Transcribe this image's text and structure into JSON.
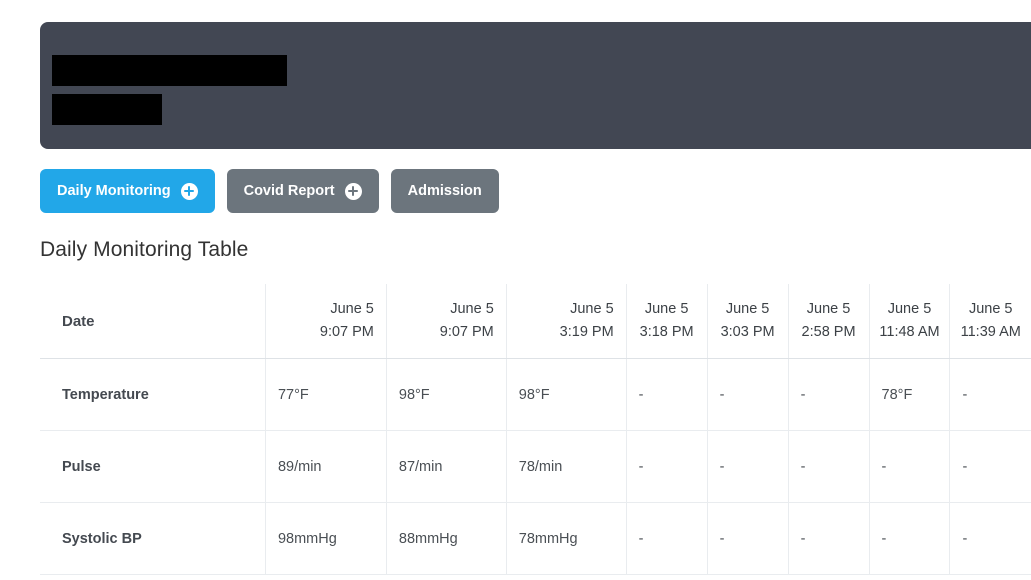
{
  "banner": {
    "name_redacted": "",
    "subtitle_redacted": "",
    "background_color": "#424753"
  },
  "actions": {
    "buttons": [
      {
        "label": "Daily Monitoring",
        "style": "primary",
        "color": "#22a7e8",
        "has_add_icon": true
      },
      {
        "label": "Covid Report",
        "style": "secondary",
        "color": "#6c757d",
        "has_add_icon": true
      },
      {
        "label": "Admission",
        "style": "secondary",
        "color": "#6c757d",
        "has_add_icon": false
      }
    ]
  },
  "section": {
    "title": "Daily Monitoring Table"
  },
  "table": {
    "row_header_label": "Date",
    "columns": [
      {
        "date": "June 5",
        "time": "9:07 PM"
      },
      {
        "date": "June 5",
        "time": "9:07 PM"
      },
      {
        "date": "June 5",
        "time": "3:19 PM"
      },
      {
        "date": "June 5",
        "time": "3:18 PM"
      },
      {
        "date": "June 5",
        "time": "3:03 PM"
      },
      {
        "date": "June 5",
        "time": "2:58 PM"
      },
      {
        "date": "June 5",
        "time": "11:48 AM"
      },
      {
        "date": "June 5",
        "time": "11:39 AM"
      }
    ],
    "rows": [
      {
        "label": "Temperature",
        "values": [
          "77°F",
          "98°F",
          "98°F",
          "-",
          "-",
          "-",
          "78°F",
          "-"
        ]
      },
      {
        "label": "Pulse",
        "values": [
          "89/min",
          "87/min",
          "78/min",
          "-",
          "-",
          "-",
          "-",
          "-"
        ]
      },
      {
        "label": "Systolic BP",
        "values": [
          "98mmHg",
          "88mmHg",
          "78mmHg",
          "-",
          "-",
          "-",
          "-",
          "-"
        ]
      }
    ]
  }
}
